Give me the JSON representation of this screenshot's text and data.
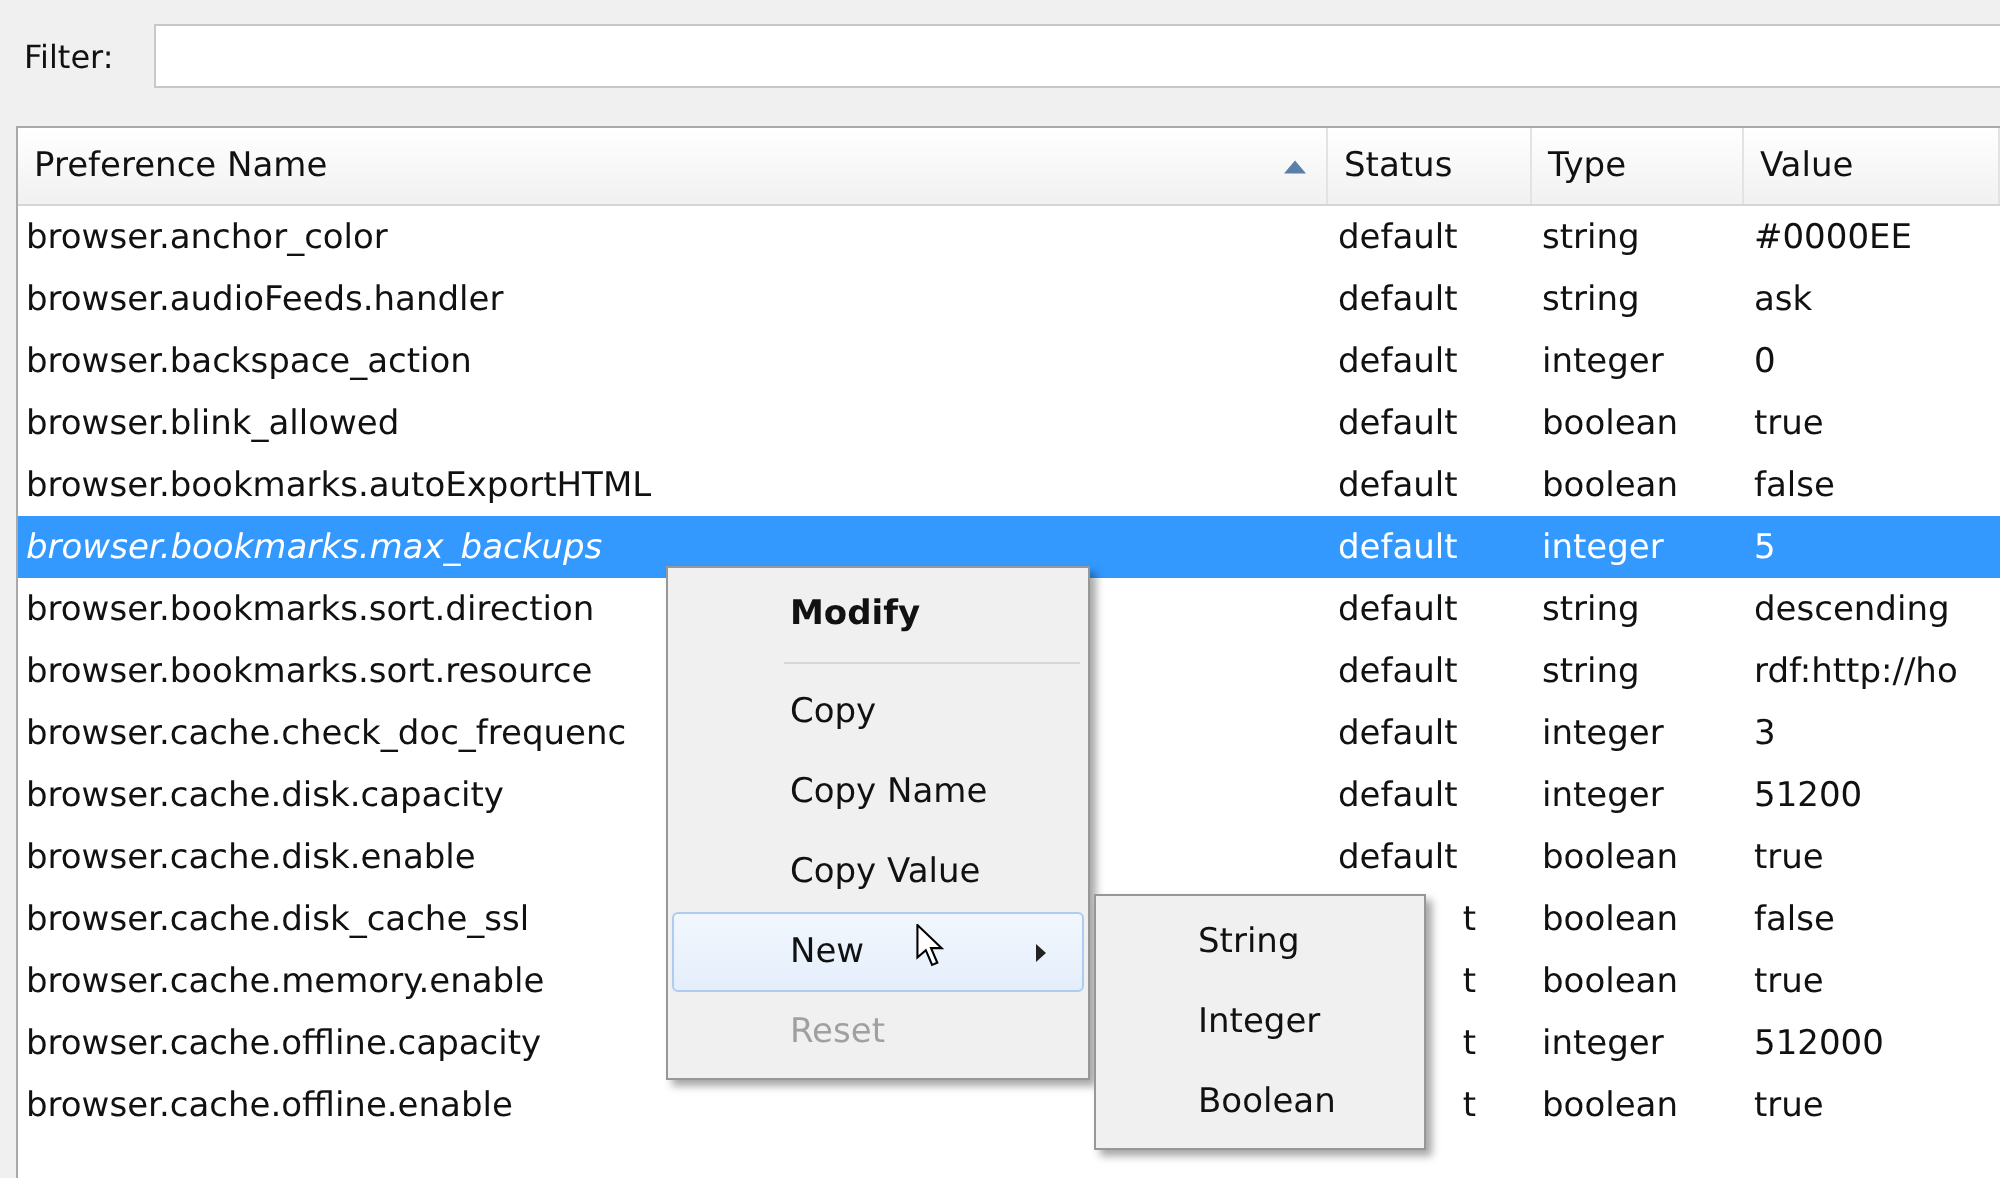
{
  "filter": {
    "label": "Filter:"
  },
  "table": {
    "columns": [
      {
        "label": "Preference Name",
        "sorted": true
      },
      {
        "label": "Status",
        "sorted": false
      },
      {
        "label": "Type",
        "sorted": false
      },
      {
        "label": "Value",
        "sorted": false
      }
    ],
    "rows": [
      {
        "name": "browser.anchor_color",
        "status": "default",
        "type": "string",
        "value": "#0000EE",
        "selected": false
      },
      {
        "name": "browser.audioFeeds.handler",
        "status": "default",
        "type": "string",
        "value": "ask",
        "selected": false
      },
      {
        "name": "browser.backspace_action",
        "status": "default",
        "type": "integer",
        "value": "0",
        "selected": false
      },
      {
        "name": "browser.blink_allowed",
        "status": "default",
        "type": "boolean",
        "value": "true",
        "selected": false
      },
      {
        "name": "browser.bookmarks.autoExportHTML",
        "status": "default",
        "type": "boolean",
        "value": "false",
        "selected": false
      },
      {
        "name": "browser.bookmarks.max_backups",
        "status": "default",
        "type": "integer",
        "value": "5",
        "selected": true
      },
      {
        "name": "browser.bookmarks.sort.direction",
        "status": "default",
        "type": "string",
        "value": "descending",
        "selected": false
      },
      {
        "name": "browser.bookmarks.sort.resource",
        "status": "default",
        "type": "string",
        "value": "rdf:http://ho",
        "selected": false
      },
      {
        "name": "browser.cache.check_doc_frequenc",
        "status": "default",
        "type": "integer",
        "value": "3",
        "selected": false
      },
      {
        "name": "browser.cache.disk.capacity",
        "status": "default",
        "type": "integer",
        "value": "51200",
        "selected": false
      },
      {
        "name": "browser.cache.disk.enable",
        "status": "default",
        "type": "boolean",
        "value": "true",
        "selected": false
      },
      {
        "name": "browser.cache.disk_cache_ssl",
        "status": "t",
        "type": "boolean",
        "value": "false",
        "selected": false
      },
      {
        "name": "browser.cache.memory.enable",
        "status": "t",
        "type": "boolean",
        "value": "true",
        "selected": false
      },
      {
        "name": "browser.cache.offline.capacity",
        "status": "t",
        "type": "integer",
        "value": "512000",
        "selected": false
      },
      {
        "name": "browser.cache.offline.enable",
        "status": "t",
        "type": "boolean",
        "value": "true",
        "selected": false
      }
    ]
  },
  "context_menu": {
    "items": [
      {
        "kind": "item",
        "label": "Modify",
        "default": true,
        "disabled": false,
        "highlighted": false,
        "submenu": false
      },
      {
        "kind": "separator"
      },
      {
        "kind": "item",
        "label": "Copy",
        "default": false,
        "disabled": false,
        "highlighted": false,
        "submenu": false
      },
      {
        "kind": "item",
        "label": "Copy Name",
        "default": false,
        "disabled": false,
        "highlighted": false,
        "submenu": false
      },
      {
        "kind": "item",
        "label": "Copy Value",
        "default": false,
        "disabled": false,
        "highlighted": false,
        "submenu": false
      },
      {
        "kind": "item",
        "label": "New",
        "default": false,
        "disabled": false,
        "highlighted": true,
        "submenu": true
      },
      {
        "kind": "item",
        "label": "Reset",
        "default": false,
        "disabled": true,
        "highlighted": false,
        "submenu": false
      }
    ]
  },
  "submenu": {
    "items": [
      {
        "label": "String"
      },
      {
        "label": "Integer"
      },
      {
        "label": "Boolean"
      }
    ]
  }
}
